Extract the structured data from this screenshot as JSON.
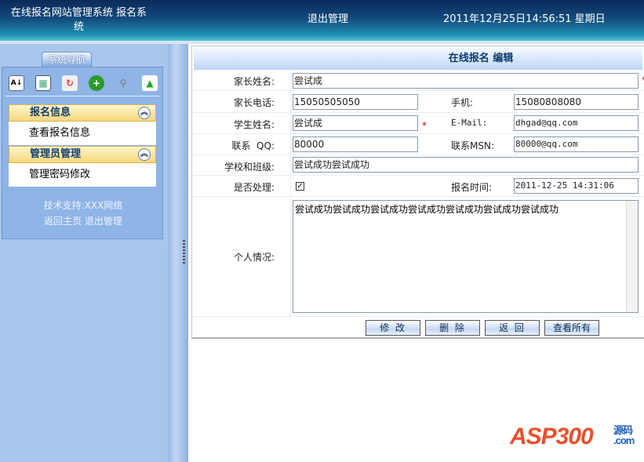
{
  "header": {
    "system_title": "在线报名网站管理系统 报名系统",
    "logout": "退出管理",
    "datetime": "2011年12月25日14:56:51 星期日"
  },
  "sidebar": {
    "tab": "系统导航",
    "icons": [
      "sort-az-icon",
      "grid-icon",
      "refresh-icon",
      "add-icon",
      "search-icon",
      "upload-icon"
    ],
    "groups": [
      {
        "title": "报名信息",
        "items": [
          "查看报名信息"
        ]
      },
      {
        "title": "管理员管理",
        "items": [
          "管理密码修改"
        ]
      }
    ],
    "support": "技术支持:XXX网络",
    "home": "返回主页",
    "logout": "退出管理"
  },
  "form": {
    "title": "在线报名 编辑",
    "parent_name": {
      "label": "家长姓名:",
      "value": "尝试成"
    },
    "parent_phone": {
      "label": "家长电话:",
      "value": "15050505050"
    },
    "mobile": {
      "label": "手机:",
      "value": "15080808080"
    },
    "student_name": {
      "label": "学生姓名:",
      "value": "尝试成"
    },
    "email": {
      "label": "E-Mail:",
      "value": "dhgad@qq.com"
    },
    "qq": {
      "label": "联系  QQ:",
      "value": "80000"
    },
    "msn": {
      "label": "联系MSN:",
      "value": "80000@qq.com"
    },
    "school": {
      "label": "学校和班级:",
      "value": "尝试成功尝试成功"
    },
    "processed": {
      "label": "是否处理:",
      "checked": true
    },
    "reg_time": {
      "label": "报名时间:",
      "value": "2011-12-25 14:31:06"
    },
    "info": {
      "label": "个人情况:",
      "value": "尝试成功尝试成功尝试成功尝试成功尝试成功尝试成功尝试成功"
    },
    "required_mark": "*",
    "buttons": {
      "edit": "修 改",
      "delete": "删 除",
      "back": "返 回",
      "view_all": "查看所有"
    }
  },
  "watermark": "ASP300源码.com"
}
